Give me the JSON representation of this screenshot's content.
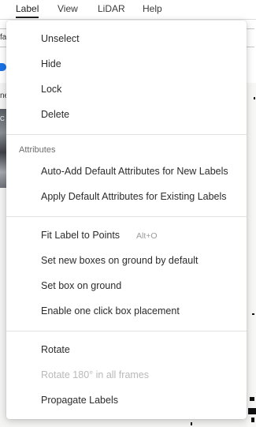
{
  "menubar": {
    "items": [
      {
        "label": "Label",
        "active": true
      },
      {
        "label": "View"
      },
      {
        "label": "LiDAR"
      },
      {
        "label": "Help"
      }
    ]
  },
  "background": {
    "field_fragment": "fa",
    "label_fragment": "ne",
    "thumb_fragment": "C"
  },
  "menu": {
    "group1": [
      "Unselect",
      "Hide",
      "Lock",
      "Delete"
    ],
    "attributes_title": "Attributes",
    "attributes": [
      "Auto-Add Default Attributes for New Labels",
      "Apply Default Attributes for Existing Labels"
    ],
    "group3": [
      {
        "label": "Fit Label to Points",
        "shortcut": "Alt+O"
      },
      {
        "label": "Set new boxes on ground by default"
      },
      {
        "label": "Set box on ground"
      },
      {
        "label": "Enable one click box placement"
      }
    ],
    "group4": [
      {
        "label": "Rotate",
        "disabled": false
      },
      {
        "label": "Rotate 180° in all frames",
        "disabled": true
      },
      {
        "label": "Propagate Labels",
        "disabled": false
      }
    ]
  },
  "colors": {
    "accent": "#1a73e8",
    "disabled_text": "#b9b9b9"
  }
}
